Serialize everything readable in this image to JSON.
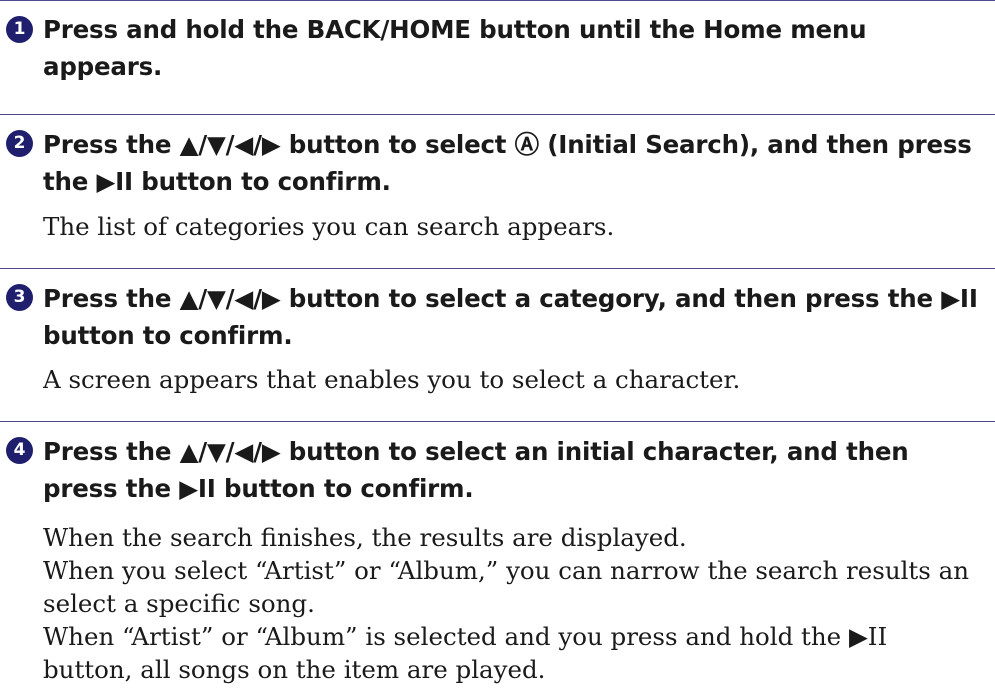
{
  "steps": [
    {
      "number": "1",
      "heading": "Press and hold the BACK/HOME button until the Home menu appears.",
      "body": []
    },
    {
      "number": "2",
      "heading": "Press the ▲/▼/◀/▶ button to select Ⓐ (Initial Search), and then press the ▶II button to confirm.",
      "body": [
        "The list of categories you can search appears."
      ]
    },
    {
      "number": "3",
      "heading": "Press the ▲/▼/◀/▶ button to select a category, and then press the ▶II button to confirm.",
      "body": [
        "A screen appears that enables you to select a character."
      ]
    },
    {
      "number": "4",
      "heading": "Press the ▲/▼/◀/▶ button to select an initial character, and then press the ▶II button to confirm.",
      "body": [
        "When the search finishes, the results are displayed.",
        "When you select “Artist” or “Album,” you can narrow the search results an",
        "select a specific song.",
        "When “Artist” or “Album” is selected and you press and hold the ▶II",
        "button, all songs on the item are played."
      ]
    }
  ]
}
